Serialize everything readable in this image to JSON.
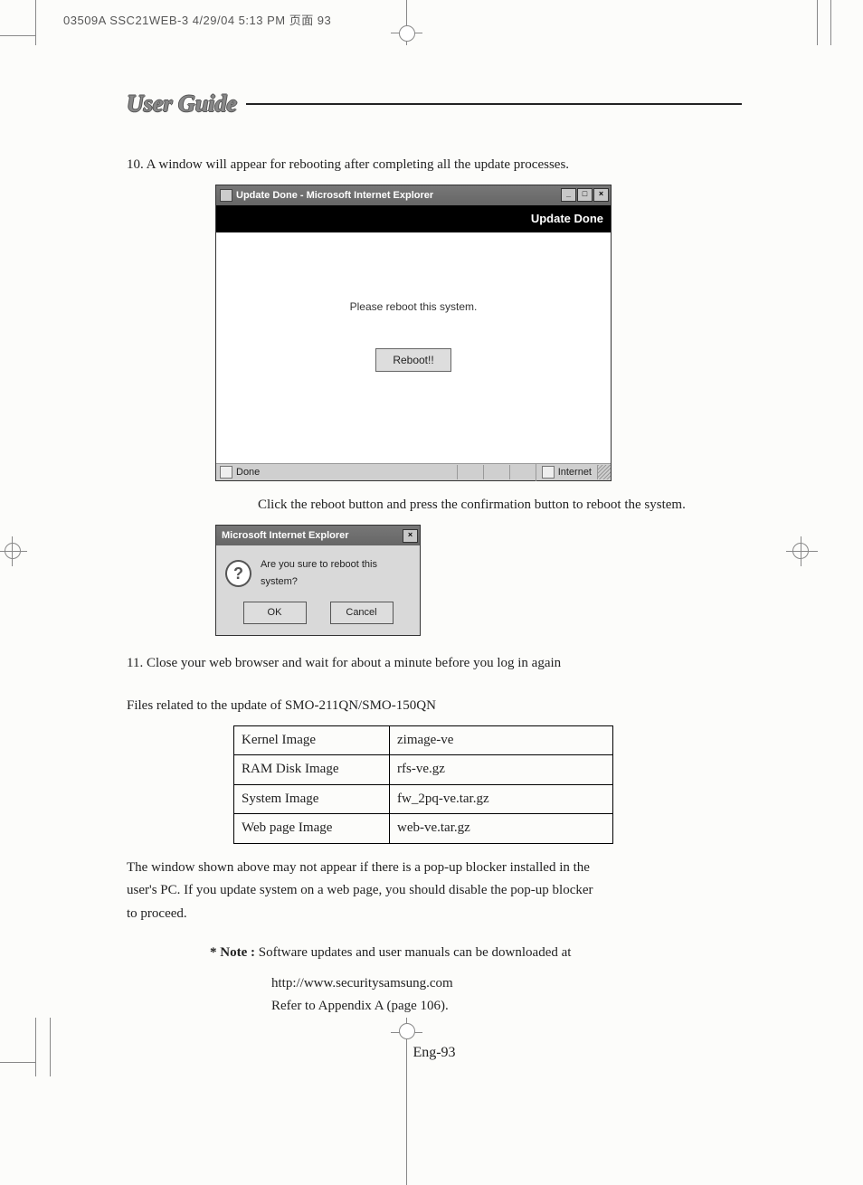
{
  "imposition_header": "03509A SSC21WEB-3  4/29/04  5:13 PM  页面 93",
  "section_title": "User Guide",
  "step10": "10. A window will appear for rebooting after completing all the update processes.",
  "win": {
    "title": "Update Done - Microsoft Internet Explorer",
    "banner": "Update Done",
    "message": "Please reboot this system.",
    "button": "Reboot!!",
    "status_done": "Done",
    "status_zone": "Internet"
  },
  "after_win": "Click the reboot button and press the confirmation button to reboot the system.",
  "dialog": {
    "title": "Microsoft Internet Explorer",
    "message": "Are you sure to reboot this system?",
    "ok": "OK",
    "cancel": "Cancel"
  },
  "step11": "11. Close your web browser and wait for about a minute before you log in again",
  "files_caption": "Files related to the update of SMO-211QN/SMO-150QN",
  "files": {
    "r0c0": "Kernel Image",
    "r0c1": "zimage-ve",
    "r1c0": "RAM Disk Image",
    "r1c1": "rfs-ve.gz",
    "r2c0": "System Image",
    "r2c1": "fw_2pq-ve.tar.gz",
    "r3c0": "Web page Image",
    "r3c1": "web-ve.tar.gz"
  },
  "popup_note1": "The window shown above may not appear if there is a pop-up blocker installed in the",
  "popup_note2": "user's PC. If you update system on a web page, you should disable the pop-up blocker",
  "popup_note3": "to proceed.",
  "note_label": "* Note : ",
  "note_text": "Software updates and user manuals can be downloaded at",
  "note_url": "http://www.securitysamsung.com",
  "note_ref": "Refer to Appendix A (page 106).",
  "page_number": "Eng-93"
}
